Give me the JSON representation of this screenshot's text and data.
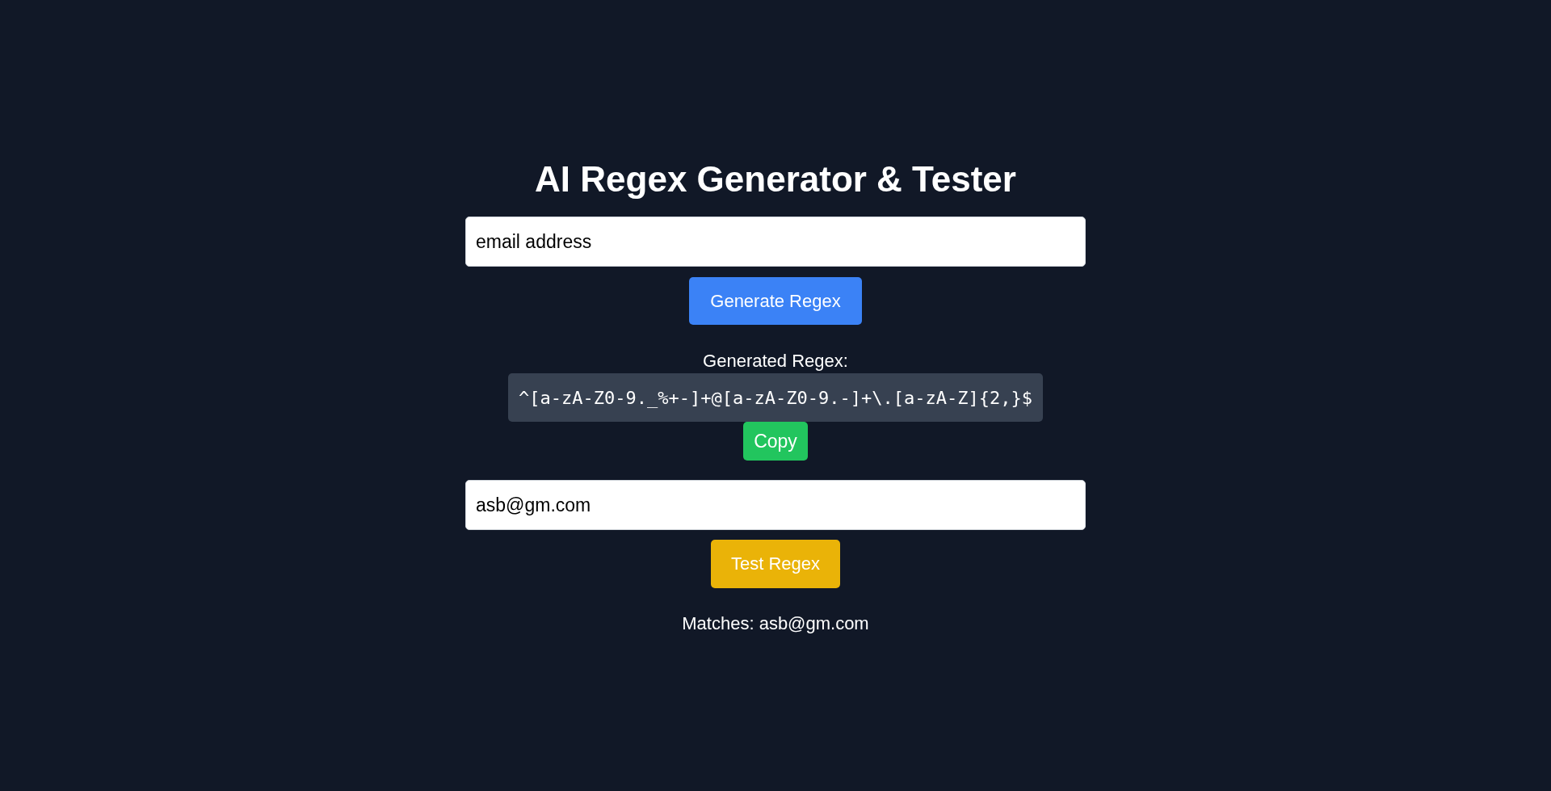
{
  "title": "AI Regex Generator & Tester",
  "description_input": {
    "value": "email address"
  },
  "generate_button": {
    "label": "Generate Regex"
  },
  "result": {
    "label": "Generated Regex:",
    "regex": "^[a-zA-Z0-9._%+-]+@[a-zA-Z0-9.-]+\\.[a-zA-Z]{2,}$",
    "copy_button": {
      "label": "Copy"
    }
  },
  "test_input": {
    "value": "asb@gm.com"
  },
  "test_button": {
    "label": "Test Regex"
  },
  "matches": {
    "text": "Matches: asb@gm.com"
  }
}
